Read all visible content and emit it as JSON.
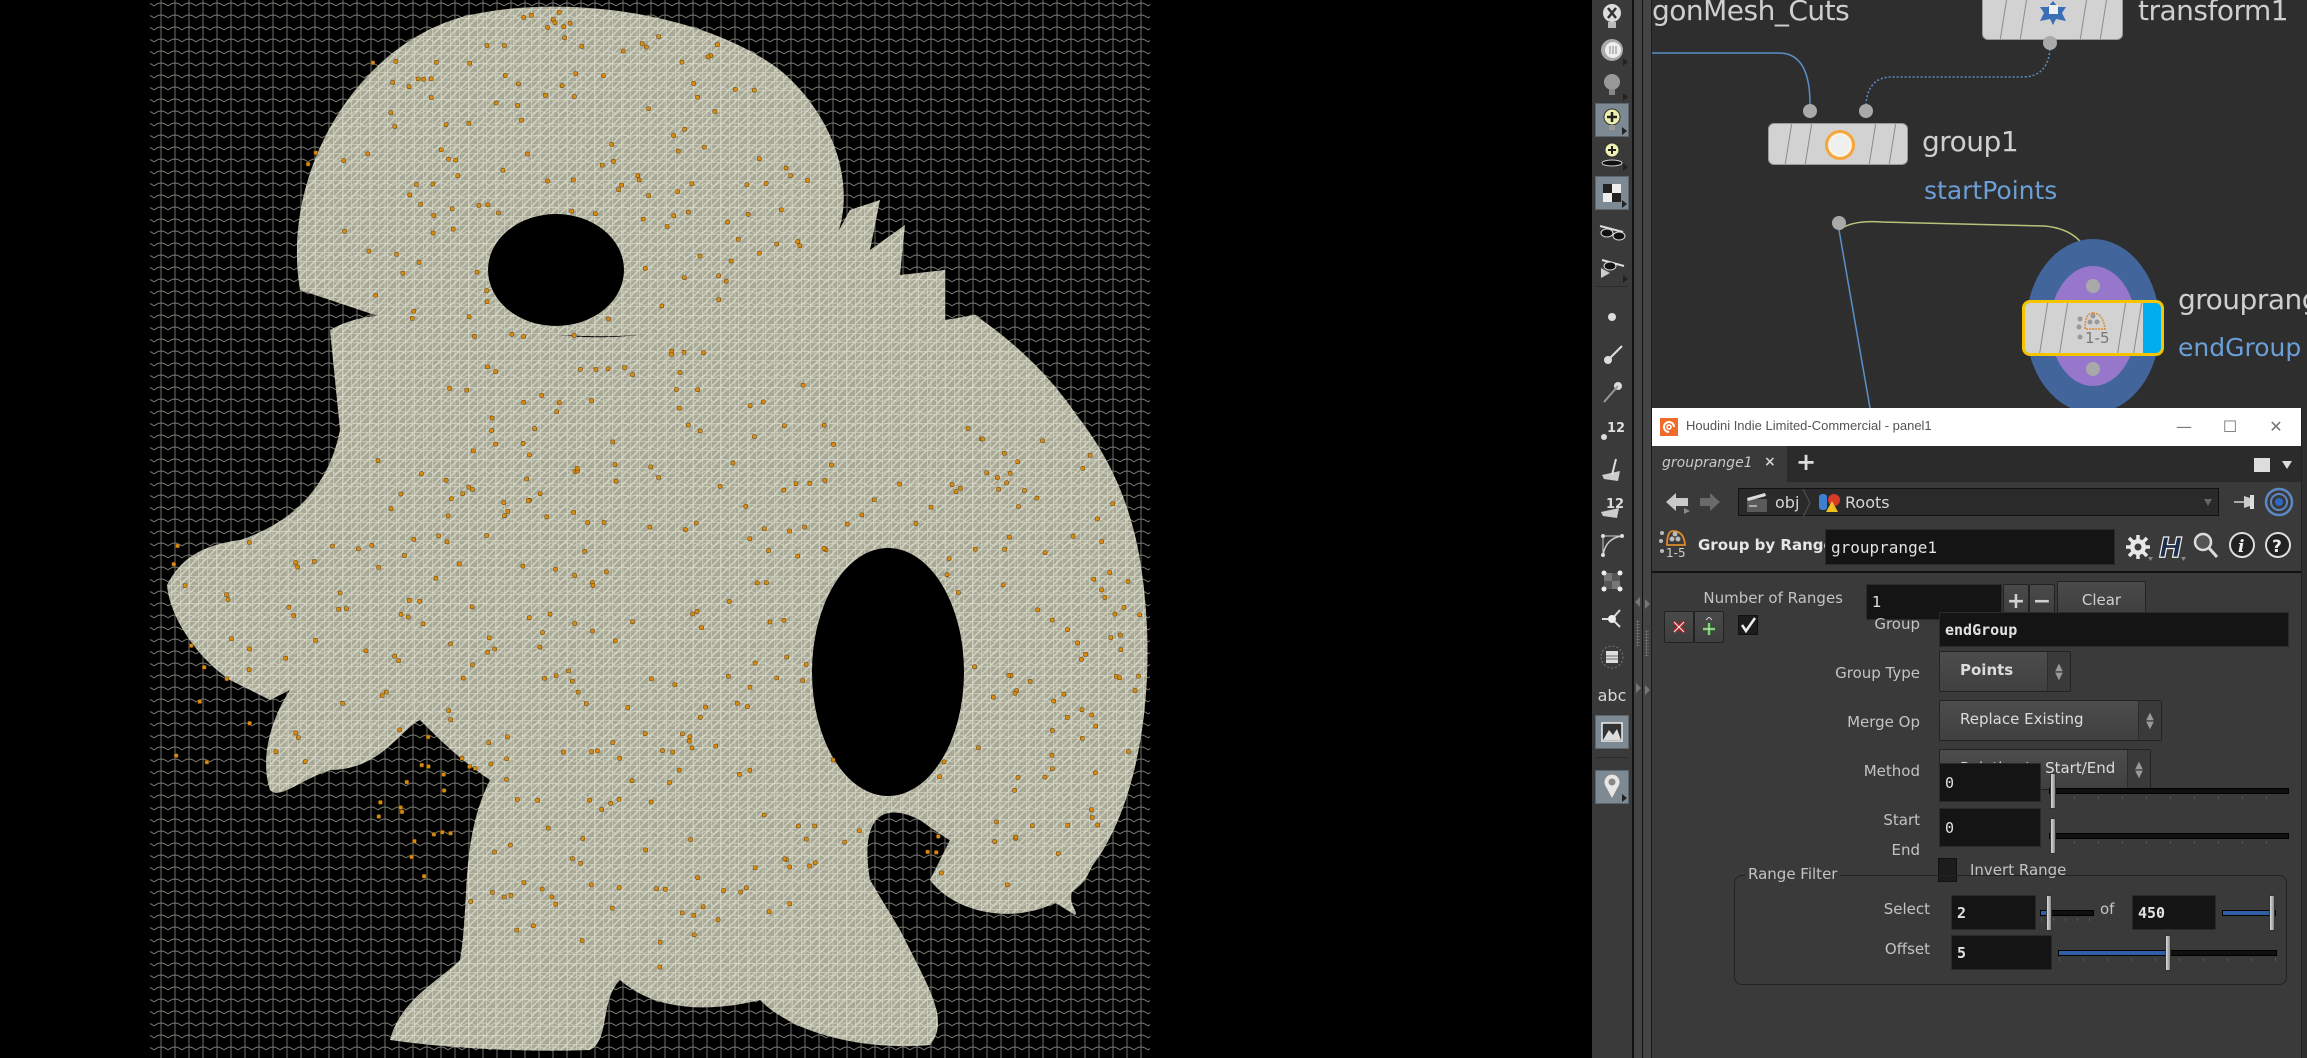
{
  "viewport": {
    "model": "dragon",
    "display_mode": "wireframe",
    "wire_color": "#c8c8b4",
    "shade_color": "#6e6e66",
    "point_color": "#d88a12",
    "background": "#000000"
  },
  "shelf": {
    "tools": [
      {
        "name": "light-off-icon"
      },
      {
        "name": "light-dome-icon"
      },
      {
        "name": "light-bulb-icon"
      },
      {
        "name": "light-add-icon",
        "active": true
      },
      {
        "name": "light-add-target-icon"
      },
      {
        "name": "shading-checker-icon",
        "active": true
      },
      {
        "name": "stereo-glasses-icon"
      },
      {
        "name": "stereo-play-icon"
      },
      {
        "name": "point-display-icon"
      },
      {
        "name": "point-normals-icon"
      },
      {
        "name": "vertex-normals-icon"
      },
      {
        "name": "point-numbers-icon",
        "badge": "12"
      },
      {
        "name": "prim-normals-icon"
      },
      {
        "name": "prim-numbers-icon",
        "badge": "12"
      },
      {
        "name": "curve-hull-icon"
      },
      {
        "name": "uv-grid-icon"
      },
      {
        "name": "handle-icon"
      },
      {
        "name": "guide-icon"
      },
      {
        "name": "text-abc-icon",
        "label": "abc"
      },
      {
        "name": "background-image-icon",
        "active": true
      },
      {
        "name": "location-pin-icon",
        "active": true
      }
    ]
  },
  "network": {
    "nodes": [
      {
        "id": "polymesh",
        "label": "gonMesh_Cuts"
      },
      {
        "id": "transform1",
        "label": "transform1"
      },
      {
        "id": "group1",
        "label": "group1",
        "flag_text": "startPoints"
      },
      {
        "id": "grouprange1",
        "label": "grouprang",
        "flag_text": "endGroup",
        "selected": true,
        "display": true
      }
    ],
    "colors": {
      "wire_blue": "#5b8fc9",
      "wire_yellow": "#b6c47a",
      "selected_outline": "#f5c400",
      "display_flag": "#00aeef",
      "ring_outer": "#42669c",
      "ring_inner": "#9677cc"
    },
    "node_icon_text": "1-5"
  },
  "panel": {
    "window_title": "Houdini Indie Limited-Commercial - panel1",
    "window_controls": {
      "minimize": "—",
      "maximize": "☐",
      "close": "✕"
    },
    "tabs": [
      {
        "label": "grouprange1",
        "close": "×"
      }
    ],
    "add_tab": "+",
    "path": {
      "root": "obj",
      "current": "Roots"
    },
    "node_type": "Group by Range",
    "node_name": "grouprange1",
    "parameters": {
      "number_of_ranges": {
        "label": "Number of Ranges",
        "value": "1",
        "plus": "+",
        "minus": "−",
        "clear": "Clear"
      },
      "group": {
        "label": "Group",
        "value": "endGroup",
        "enabled": true
      },
      "group_type": {
        "label": "Group Type",
        "value": "Points"
      },
      "merge_op": {
        "label": "Merge Op",
        "value": "Replace Existing"
      },
      "method": {
        "label": "Method",
        "value": "Relative to Start/End"
      },
      "start": {
        "label": "Start",
        "value": "0",
        "slider_fraction": 0.0
      },
      "end": {
        "label": "End",
        "value": "0",
        "slider_fraction": 0.0
      },
      "invert_range": {
        "label": "Invert Range",
        "checked": false
      },
      "range_filter": {
        "title": "Range Filter",
        "select": {
          "label": "Select",
          "value": "2",
          "of_label": "of",
          "of_value": "450",
          "select_fraction": 0.1,
          "of_fraction": 1.0
        },
        "offset": {
          "label": "Offset",
          "value": "5",
          "slider_fraction": 0.5
        }
      }
    }
  }
}
